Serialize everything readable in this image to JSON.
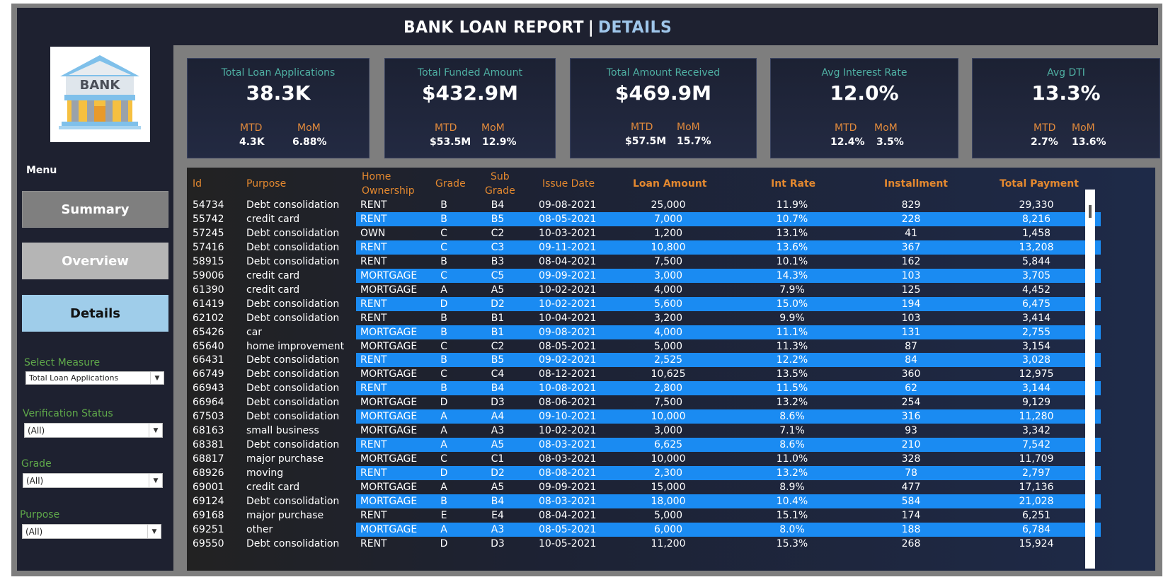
{
  "header": {
    "title_main": "BANK LOAN REPORT",
    "separator": "|",
    "title_accent": "DETAILS"
  },
  "logo": {
    "text": "BANK"
  },
  "sidebar": {
    "menu_label": "Menu",
    "buttons": [
      {
        "label": "Summary"
      },
      {
        "label": "Overview"
      },
      {
        "label": "Details"
      }
    ],
    "filters": [
      {
        "label": "Select Measure",
        "value": "Total Loan Applications"
      },
      {
        "label": "Verification Status",
        "value": "(All)"
      },
      {
        "label": "Grade",
        "value": "(All)"
      },
      {
        "label": "Purpose",
        "value": "(All)"
      }
    ]
  },
  "kpis": [
    {
      "title": "Total Loan Applications",
      "value": "38.3K",
      "mtd_label": "MTD",
      "mtd": "4.3K",
      "mom_label": "MoM",
      "mom": "6.88%"
    },
    {
      "title": "Total Funded Amount",
      "value": "$432.9M",
      "mtd_label": "MTD",
      "mtd": "$53.5M",
      "mom_label": "MoM",
      "mom": "12.9%"
    },
    {
      "title": "Total Amount Received",
      "value": "$469.9M",
      "mtd_label": "MTD",
      "mtd": "$57.5M",
      "mom_label": "MoM",
      "mom": "15.7%"
    },
    {
      "title": "Avg Interest Rate",
      "value": "12.0%",
      "mtd_label": "MTD",
      "mtd": "12.4%",
      "mom_label": "MoM",
      "mom": "3.5%"
    },
    {
      "title": "Avg DTI",
      "value": "13.3%",
      "mtd_label": "MTD",
      "mtd": "2.7%",
      "mom_label": "MoM",
      "mom": "13.6%"
    }
  ],
  "table": {
    "headers": {
      "id": "Id",
      "purpose": "Purpose",
      "home_1": "Home",
      "home_2": "Ownership",
      "grade": "Grade",
      "sub_1": "Sub",
      "sub_2": "Grade",
      "issue_date": "Issue Date",
      "loan_amount": "Loan Amount",
      "int_rate": "Int Rate",
      "installment": "Installment",
      "total_payment": "Total Payment"
    },
    "rows": [
      [
        "54734",
        "Debt consolidation",
        "RENT",
        "B",
        "B4",
        "09-08-2021",
        "25,000",
        "11.9%",
        "829",
        "29,330"
      ],
      [
        "55742",
        "credit card",
        "RENT",
        "B",
        "B5",
        "08-05-2021",
        "7,000",
        "10.7%",
        "228",
        "8,216"
      ],
      [
        "57245",
        "Debt consolidation",
        "OWN",
        "C",
        "C2",
        "10-03-2021",
        "1,200",
        "13.1%",
        "41",
        "1,458"
      ],
      [
        "57416",
        "Debt consolidation",
        "RENT",
        "C",
        "C3",
        "09-11-2021",
        "10,800",
        "13.6%",
        "367",
        "13,208"
      ],
      [
        "58915",
        "Debt consolidation",
        "RENT",
        "B",
        "B3",
        "08-04-2021",
        "7,500",
        "10.1%",
        "162",
        "5,844"
      ],
      [
        "59006",
        "credit card",
        "MORTGAGE",
        "C",
        "C5",
        "09-09-2021",
        "3,000",
        "14.3%",
        "103",
        "3,705"
      ],
      [
        "61390",
        "credit card",
        "MORTGAGE",
        "A",
        "A5",
        "10-02-2021",
        "4,000",
        "7.9%",
        "125",
        "4,452"
      ],
      [
        "61419",
        "Debt consolidation",
        "RENT",
        "D",
        "D2",
        "10-02-2021",
        "5,600",
        "15.0%",
        "194",
        "6,475"
      ],
      [
        "62102",
        "Debt consolidation",
        "RENT",
        "B",
        "B1",
        "10-04-2021",
        "3,200",
        "9.9%",
        "103",
        "3,414"
      ],
      [
        "65426",
        "car",
        "MORTGAGE",
        "B",
        "B1",
        "09-08-2021",
        "4,000",
        "11.1%",
        "131",
        "2,755"
      ],
      [
        "65640",
        "home improvement",
        "MORTGAGE",
        "C",
        "C2",
        "08-05-2021",
        "5,000",
        "11.3%",
        "87",
        "3,154"
      ],
      [
        "66431",
        "Debt consolidation",
        "RENT",
        "B",
        "B5",
        "09-02-2021",
        "2,525",
        "12.2%",
        "84",
        "3,028"
      ],
      [
        "66749",
        "Debt consolidation",
        "MORTGAGE",
        "C",
        "C4",
        "08-12-2021",
        "10,625",
        "13.5%",
        "360",
        "12,975"
      ],
      [
        "66943",
        "Debt consolidation",
        "RENT",
        "B",
        "B4",
        "10-08-2021",
        "2,800",
        "11.5%",
        "62",
        "3,144"
      ],
      [
        "66964",
        "Debt consolidation",
        "MORTGAGE",
        "D",
        "D3",
        "08-06-2021",
        "7,500",
        "13.2%",
        "254",
        "9,129"
      ],
      [
        "67503",
        "Debt consolidation",
        "MORTGAGE",
        "A",
        "A4",
        "09-10-2021",
        "10,000",
        "8.6%",
        "316",
        "11,280"
      ],
      [
        "68163",
        "small business",
        "MORTGAGE",
        "A",
        "A3",
        "10-02-2021",
        "3,000",
        "7.1%",
        "93",
        "3,342"
      ],
      [
        "68381",
        "Debt consolidation",
        "RENT",
        "A",
        "A5",
        "08-03-2021",
        "6,625",
        "8.6%",
        "210",
        "7,542"
      ],
      [
        "68817",
        "major purchase",
        "MORTGAGE",
        "C",
        "C1",
        "08-03-2021",
        "10,000",
        "11.0%",
        "328",
        "11,709"
      ],
      [
        "68926",
        "moving",
        "RENT",
        "D",
        "D2",
        "08-08-2021",
        "2,300",
        "13.2%",
        "78",
        "2,797"
      ],
      [
        "69001",
        "credit card",
        "MORTGAGE",
        "A",
        "A5",
        "09-09-2021",
        "15,000",
        "8.9%",
        "477",
        "17,136"
      ],
      [
        "69124",
        "Debt consolidation",
        "MORTGAGE",
        "B",
        "B4",
        "08-03-2021",
        "18,000",
        "10.4%",
        "584",
        "21,028"
      ],
      [
        "69168",
        "major purchase",
        "RENT",
        "E",
        "E4",
        "08-04-2021",
        "5,000",
        "15.1%",
        "174",
        "6,251"
      ],
      [
        "69251",
        "other",
        "MORTGAGE",
        "A",
        "A3",
        "08-05-2021",
        "6,000",
        "8.0%",
        "188",
        "6,784"
      ],
      [
        "69550",
        "Debt consolidation",
        "RENT",
        "D",
        "D3",
        "10-05-2021",
        "11,200",
        "15.3%",
        "268",
        "15,924"
      ]
    ]
  }
}
